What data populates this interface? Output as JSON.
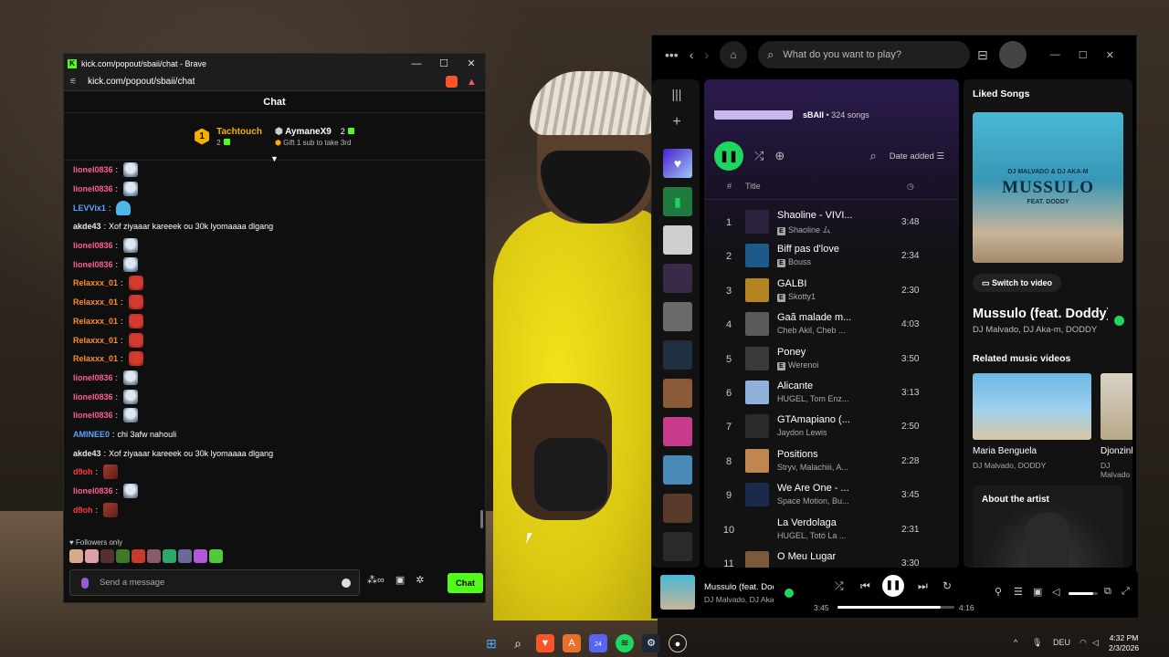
{
  "chat_window": {
    "title": "kick.com/popout/sbaii/chat - Brave",
    "url": "kick.com/popout/sbaii/chat",
    "header": "Chat",
    "leaderboard": [
      {
        "rank": "1",
        "name": "Tachtouch",
        "count": "2"
      },
      {
        "name": "AymaneX9",
        "count": "2",
        "subtitle": "Gift 1 sub to take 3rd"
      }
    ],
    "messages": [
      {
        "user": "lionel0836",
        "text": "",
        "emotes": [
          "bird"
        ],
        "color": "#ff5c9a"
      },
      {
        "user": "lionel0836",
        "text": "",
        "emotes": [
          "bird"
        ],
        "color": "#ff5c9a"
      },
      {
        "user": "LEVVix1",
        "text": "",
        "emotes": [
          "ghost"
        ],
        "color": "#5aa7ff"
      },
      {
        "user": "akde43",
        "text": "Xof ziyaaar kareeek ou 30k lyomaaaa dlgang",
        "emotes": [],
        "color": "#e8e8e8"
      },
      {
        "user": "lionel0836",
        "text": "",
        "emotes": [
          "bird"
        ],
        "color": "#ff5c9a"
      },
      {
        "user": "lionel0836",
        "text": "",
        "emotes": [
          "bird"
        ],
        "color": "#ff5c9a"
      },
      {
        "user": "Relaxxx_01",
        "text": "",
        "emotes": [
          "mask"
        ],
        "color": "#ff8c2b"
      },
      {
        "user": "Relaxxx_01",
        "text": "",
        "emotes": [
          "mask"
        ],
        "color": "#ff8c2b"
      },
      {
        "user": "Relaxxx_01",
        "text": "",
        "emotes": [
          "mask"
        ],
        "color": "#ff8c2b"
      },
      {
        "user": "Relaxxx_01",
        "text": "",
        "emotes": [
          "mask"
        ],
        "color": "#ff8c2b"
      },
      {
        "user": "Relaxxx_01",
        "text": "",
        "emotes": [
          "mask"
        ],
        "color": "#ff8c2b"
      },
      {
        "user": "lionel0836",
        "text": "",
        "emotes": [
          "bird"
        ],
        "color": "#ff5c9a"
      },
      {
        "user": "lionel0836",
        "text": "",
        "emotes": [
          "bird"
        ],
        "color": "#ff5c9a"
      },
      {
        "user": "lionel0836",
        "text": "",
        "emotes": [
          "bird"
        ],
        "color": "#ff5c9a"
      },
      {
        "user": "AMINEE0",
        "text": "chi 3afw nahouli",
        "emotes": [],
        "color": "#5aa7ff"
      },
      {
        "user": "akde43",
        "text": "Xof ziyaaar kareeek ou 30k lyomaaaa dlgang",
        "emotes": [],
        "color": "#e8e8e8"
      },
      {
        "user": "d9oh",
        "text": "",
        "emotes": [
          "d90"
        ],
        "color": "#ff3b3b"
      },
      {
        "user": "lionel0836",
        "text": "",
        "emotes": [
          "bird"
        ],
        "color": "#ff5c9a"
      },
      {
        "user": "d9oh",
        "text": "",
        "emotes": [
          "d90"
        ],
        "color": "#ff3b3b"
      }
    ],
    "followers_only": "Followers only",
    "input_placeholder": "Send a message",
    "chat_button": "Chat"
  },
  "spotify": {
    "search_placeholder": "What do you want to play?",
    "playlist_owner": "sBAII",
    "playlist_count": "• 324 songs",
    "sort_label": "Date added",
    "column_title": "Title",
    "tracks": [
      {
        "num": "1",
        "title": "Shaoline - VIVI...",
        "artist": "Shaoline ム",
        "explicit": true,
        "duration": "3:48",
        "art": "#2d2140"
      },
      {
        "num": "2",
        "title": "Biff pas d'love",
        "artist": "Bouss",
        "explicit": true,
        "duration": "2:34",
        "art": "#1d5a8a"
      },
      {
        "num": "3",
        "title": "GALBI",
        "artist": "Skotty1",
        "explicit": true,
        "duration": "2:30",
        "art": "#b48420"
      },
      {
        "num": "4",
        "title": "Gaã malade m...",
        "artist": "Cheb Akil, Cheb ...",
        "explicit": false,
        "duration": "4:03",
        "art": "#5a5a5a"
      },
      {
        "num": "5",
        "title": "Poney",
        "artist": "Werenoi",
        "explicit": true,
        "duration": "3:50",
        "art": "#3a3a3a"
      },
      {
        "num": "6",
        "title": "Alicante",
        "artist": "HUGEL, Tom Enz...",
        "explicit": false,
        "duration": "3:13",
        "art": "#8fb0d8"
      },
      {
        "num": "7",
        "title": "GTAmapiano (...",
        "artist": "Jaydon Lewis",
        "explicit": false,
        "duration": "2:50",
        "art": "#2a2a2a"
      },
      {
        "num": "8",
        "title": "Positions",
        "artist": "Stryv, Malachiii, A...",
        "explicit": false,
        "duration": "2:28",
        "art": "#c08650"
      },
      {
        "num": "9",
        "title": "We Are One - ...",
        "artist": "Space Motion, Bu...",
        "explicit": false,
        "duration": "3:45",
        "art": "#1a2a48"
      },
      {
        "num": "10",
        "title": "La Verdolaga",
        "artist": "HUGEL, Totó La ...",
        "explicit": false,
        "duration": "2:31",
        "art": "#111111"
      },
      {
        "num": "11",
        "title": "O Meu Lugar",
        "artist": "",
        "explicit": false,
        "duration": "3:30",
        "art": "#7a5a3a"
      }
    ],
    "right_panel": {
      "heading": "Liked Songs",
      "cover_line1": "DJ MALVADO & DJ AKA-M",
      "cover_line2": "MUSSULO",
      "cover_line3": "FEAT. DODDY",
      "switch_video": "Switch to video",
      "song_title": "Mussulo (feat. Doddy)",
      "song_artists": "DJ Malvado, DJ Aka-m, DODDY",
      "related_heading": "Related music videos",
      "videos": [
        {
          "title": "Maria Benguela",
          "artists": "DJ Malvado, DODDY"
        },
        {
          "title": "Djonzinho",
          "artists": "DJ Malvado"
        }
      ],
      "about_heading": "About the artist"
    },
    "player": {
      "song": "Mussulo (feat. Doddy)",
      "artists": "DJ Malvado, DJ Aka-m",
      "elapsed": "3:45",
      "total": "4:16",
      "progress": 0.88,
      "volume": 0.85
    }
  },
  "taskbar": {
    "lang": "DEU",
    "time": "4:32 PM",
    "date": "2/3/2026",
    "discord_badge": "24"
  }
}
